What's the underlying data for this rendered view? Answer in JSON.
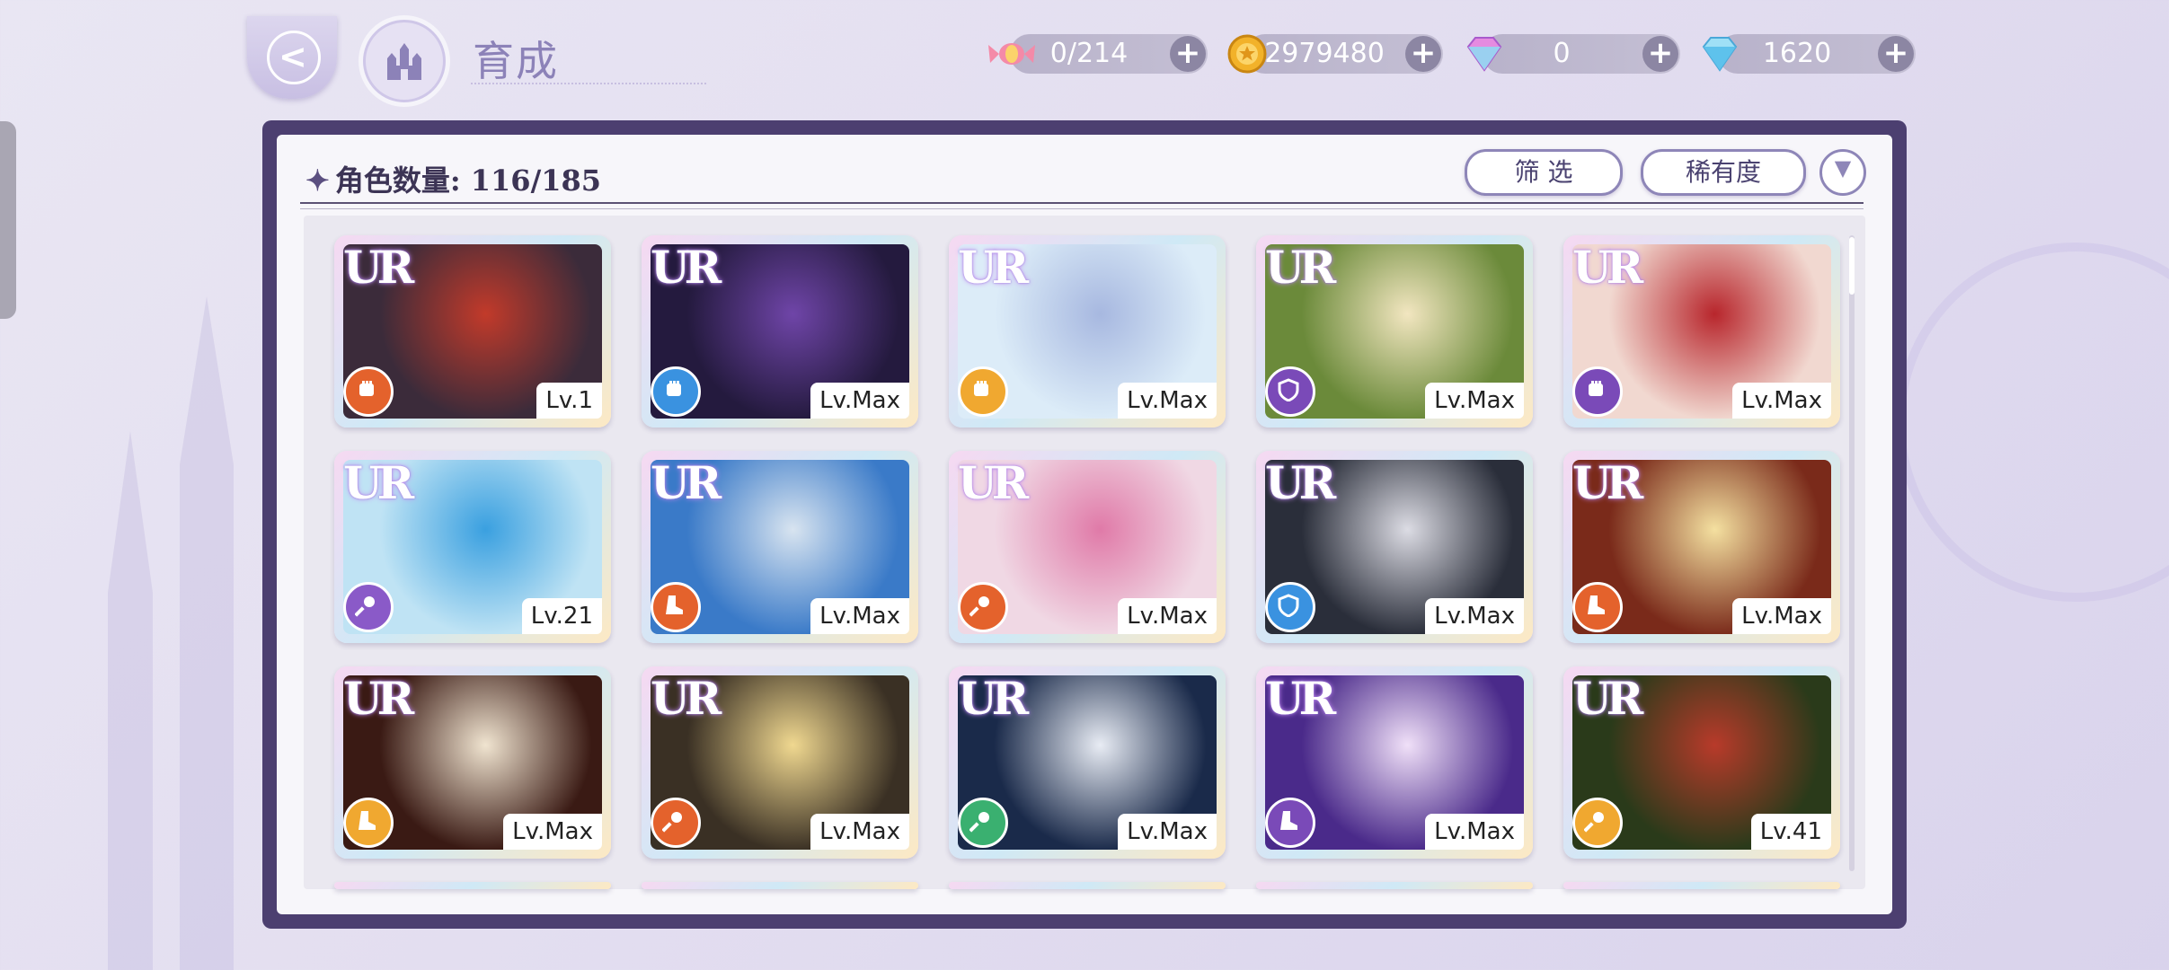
{
  "header": {
    "title": "育成",
    "back_icon": "back-arrow-icon",
    "home_icon": "castle-icon"
  },
  "resources": [
    {
      "name": "candy",
      "icon": "candy-icon",
      "value": "0/214"
    },
    {
      "name": "coin",
      "icon": "coin-icon",
      "value": "2979480"
    },
    {
      "name": "pink-gem",
      "icon": "pink-gem-icon",
      "value": "0"
    },
    {
      "name": "blue-gem",
      "icon": "blue-gem-icon",
      "value": "1620"
    }
  ],
  "panel": {
    "count_label": "角色数量: 116/185",
    "filter_label": "筛 选",
    "sort_label": "稀有度",
    "sort_direction_icon": "chevron-down-icon"
  },
  "cards": [
    {
      "rarity": "UR",
      "attr_color": "#e4622c",
      "attr_icon": "fist-icon",
      "level": "Lv.1",
      "art": [
        "#3b2b3a",
        "#c23a2a",
        "#ffb03a"
      ]
    },
    {
      "rarity": "UR",
      "attr_color": "#3a92e0",
      "attr_icon": "fist-icon",
      "level": "Lv.Max",
      "art": [
        "#241a3e",
        "#6f45a8",
        "#b9a8e8"
      ]
    },
    {
      "rarity": "UR",
      "attr_color": "#f0a830",
      "attr_icon": "fist-icon",
      "level": "Lv.Max",
      "art": [
        "#dcecf8",
        "#a7b8e0",
        "#5b4f7a"
      ]
    },
    {
      "rarity": "UR",
      "attr_color": "#7a4ab8",
      "attr_icon": "shield-icon",
      "level": "Lv.Max",
      "art": [
        "#6b8a3a",
        "#f2e6c0",
        "#d77a88"
      ]
    },
    {
      "rarity": "UR",
      "attr_color": "#7a4ab8",
      "attr_icon": "fist-icon",
      "level": "Lv.Max",
      "art": [
        "#f1d8d0",
        "#b8262c",
        "#3a2326"
      ]
    },
    {
      "rarity": "UR",
      "attr_color": "#8a5ac8",
      "attr_icon": "wand-icon",
      "level": "Lv.21",
      "art": [
        "#bfe3f4",
        "#3aa0e0",
        "#f4f6fa"
      ]
    },
    {
      "rarity": "UR",
      "attr_color": "#e4622c",
      "attr_icon": "boot-icon",
      "level": "Lv.Max",
      "art": [
        "#3a7ac8",
        "#d8e4f0",
        "#8aa0b8"
      ]
    },
    {
      "rarity": "UR",
      "attr_color": "#e4622c",
      "attr_icon": "wand-icon",
      "level": "Lv.Max",
      "art": [
        "#f0d8e4",
        "#e07aa8",
        "#2a2a3a"
      ]
    },
    {
      "rarity": "UR",
      "attr_color": "#3a92e0",
      "attr_icon": "shield-icon",
      "level": "Lv.Max",
      "art": [
        "#2a2e3a",
        "#dcdce4",
        "#6a7082"
      ]
    },
    {
      "rarity": "UR",
      "attr_color": "#e4622c",
      "attr_icon": "boot-icon",
      "level": "Lv.Max",
      "art": [
        "#7a2a1a",
        "#f4e0a0",
        "#c89050"
      ]
    },
    {
      "rarity": "UR",
      "attr_color": "#f0a830",
      "attr_icon": "boot-icon",
      "level": "Lv.Max",
      "art": [
        "#3a1a14",
        "#f0e4d0",
        "#6a3a2a"
      ]
    },
    {
      "rarity": "UR",
      "attr_color": "#e4622c",
      "attr_icon": "wand-icon",
      "level": "Lv.Max",
      "art": [
        "#3a3024",
        "#f0d890",
        "#b8944a"
      ]
    },
    {
      "rarity": "UR",
      "attr_color": "#3ab070",
      "attr_icon": "wand-icon",
      "level": "Lv.Max",
      "art": [
        "#1a2a4a",
        "#e8ecf4",
        "#6a4aa8"
      ]
    },
    {
      "rarity": "UR",
      "attr_color": "#7a4ab8",
      "attr_icon": "boot-icon",
      "level": "Lv.Max",
      "art": [
        "#4a2a8a",
        "#f0e0f8",
        "#c86ad8"
      ]
    },
    {
      "rarity": "UR",
      "attr_color": "#f0a830",
      "attr_icon": "wand-icon",
      "level": "Lv.41",
      "art": [
        "#2a3a1a",
        "#b83a2a",
        "#6a7a3a"
      ]
    }
  ]
}
